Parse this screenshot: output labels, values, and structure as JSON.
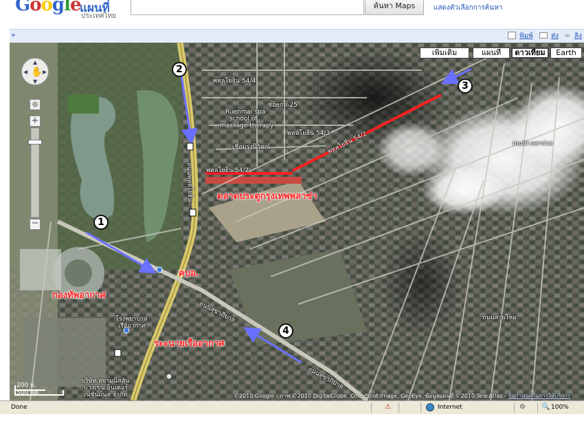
{
  "header": {
    "logo_letters": [
      "G",
      "o",
      "o",
      "g",
      "l",
      "e"
    ],
    "product": "แผนที่",
    "country": "ประเทศไทย",
    "search_button": "ค้นหา Maps",
    "search_options": "แสดงตัวเลือกการค้นหา"
  },
  "toolbar": {
    "collapse": "»",
    "print": "พิมพ์",
    "send": "ส่ง",
    "link": "ลิง"
  },
  "map_types": {
    "more": "เพิ่มเติม",
    "map": "แผนที่",
    "satellite": "ดาวเทียม",
    "earth": "Earth"
  },
  "scale": {
    "metric": "200 ม.",
    "imperial": "500 ฟุต"
  },
  "markers": [
    "1",
    "2",
    "3",
    "4"
  ],
  "annotations": {
    "market": "ตลาดประตูกรุงเทพพลาซ่า",
    "police": "คปอ.",
    "airforce": "กองทัพอากาศ",
    "canal": "ระะนายเรืออากาศ"
  },
  "street_labels": {
    "phahon_54_2_a": "พหลโยธิน 54/2",
    "phahon_54_2_b": "พหลโยธิน 54/2",
    "phahon_54_4": "พหลโยธิน 54/4",
    "phahon_54_3": "พหลโยธิน 54/3",
    "soi_25": "ซอยกม-25",
    "spa": "Ruenmai spa",
    "spa2": "school of",
    "spa3": "massage therapy",
    "chalerm": "เชื่อมรุ่งนิวัฒน์",
    "phaholyothin": "ถนนพหลโยธิน",
    "sukhaphiban": "ถนนสุขาภิบาล",
    "sukhaphiban2": "ถนนสุขาภิบาล",
    "saimai": "ถนนสายไหม",
    "hospital": "โรงพยาบาล",
    "hospital2": "เรืออากาศ",
    "company": "บริษัท สยามนิสสัน",
    "company2": "บางเขน อินเตอร์",
    "company3": "เนชั่นแนล จำกัด",
    "auto": "multi-service"
  },
  "copyright": {
    "text": "©2010 Google - ภาพ ©2010 DigitalGlobe, Cnes/Spot Image, GeoEye, ข้อมูลแผนที่ ©2010 Tele Atlas - ",
    "terms": "ข้อกำหนดในการให้บริการ"
  },
  "status": {
    "text": "Done",
    "zone": "Internet",
    "zoom": "100%"
  },
  "colors": {
    "route_red": "#ff2020",
    "arrow_blue": "#6a70ff"
  }
}
